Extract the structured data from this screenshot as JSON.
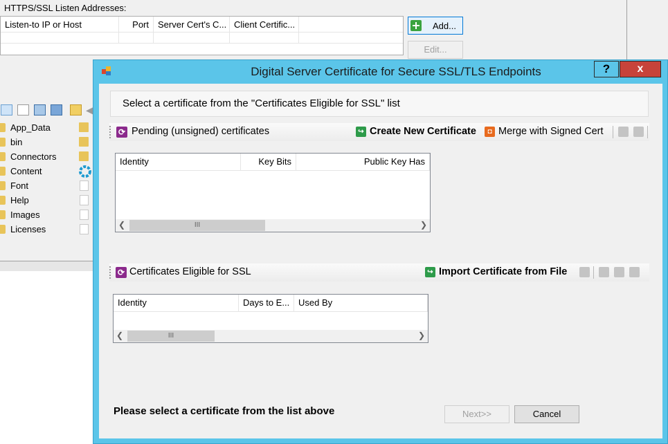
{
  "background": {
    "listen_label": "HTTPS/SSL Listen Addresses:",
    "columns": [
      "Listen-to IP or Host",
      "Port",
      "Server Cert's C...",
      "Client Certific..."
    ],
    "add_label": "Add...",
    "edit_label": "Edit...",
    "tree_items": [
      "App_Data",
      "bin",
      "Connectors",
      "Content",
      "Font",
      "Help",
      "Images",
      "Licenses"
    ]
  },
  "dialog": {
    "title": "Digital Server Certificate for Secure SSL/TLS Endpoints",
    "help_label": "?",
    "close_label": "x",
    "instruction": "Select a certificate from the \"Certificates Eligible for SSL\" list",
    "pending": {
      "title": "Pending (unsigned) certificates",
      "create_label": "Create New Certificate",
      "merge_label": "Merge with Signed Cert",
      "columns": [
        "Identity",
        "Key Bits",
        "Public Key Has"
      ]
    },
    "eligible": {
      "title": "Certificates Eligible for SSL",
      "import_label": "Import Certificate from File",
      "columns": [
        "Identity",
        "Days to E...",
        "Used By"
      ]
    },
    "footer_message": "Please select a certificate from the list above",
    "next_label": "Next>>",
    "cancel_label": "Cancel"
  },
  "colors": {
    "title_bar": "#5bc5e9",
    "close_button": "#c7433a",
    "section_icon": "#8b2a8c",
    "create_icon": "#2e9b4a",
    "merge_icon": "#e86a1e"
  }
}
